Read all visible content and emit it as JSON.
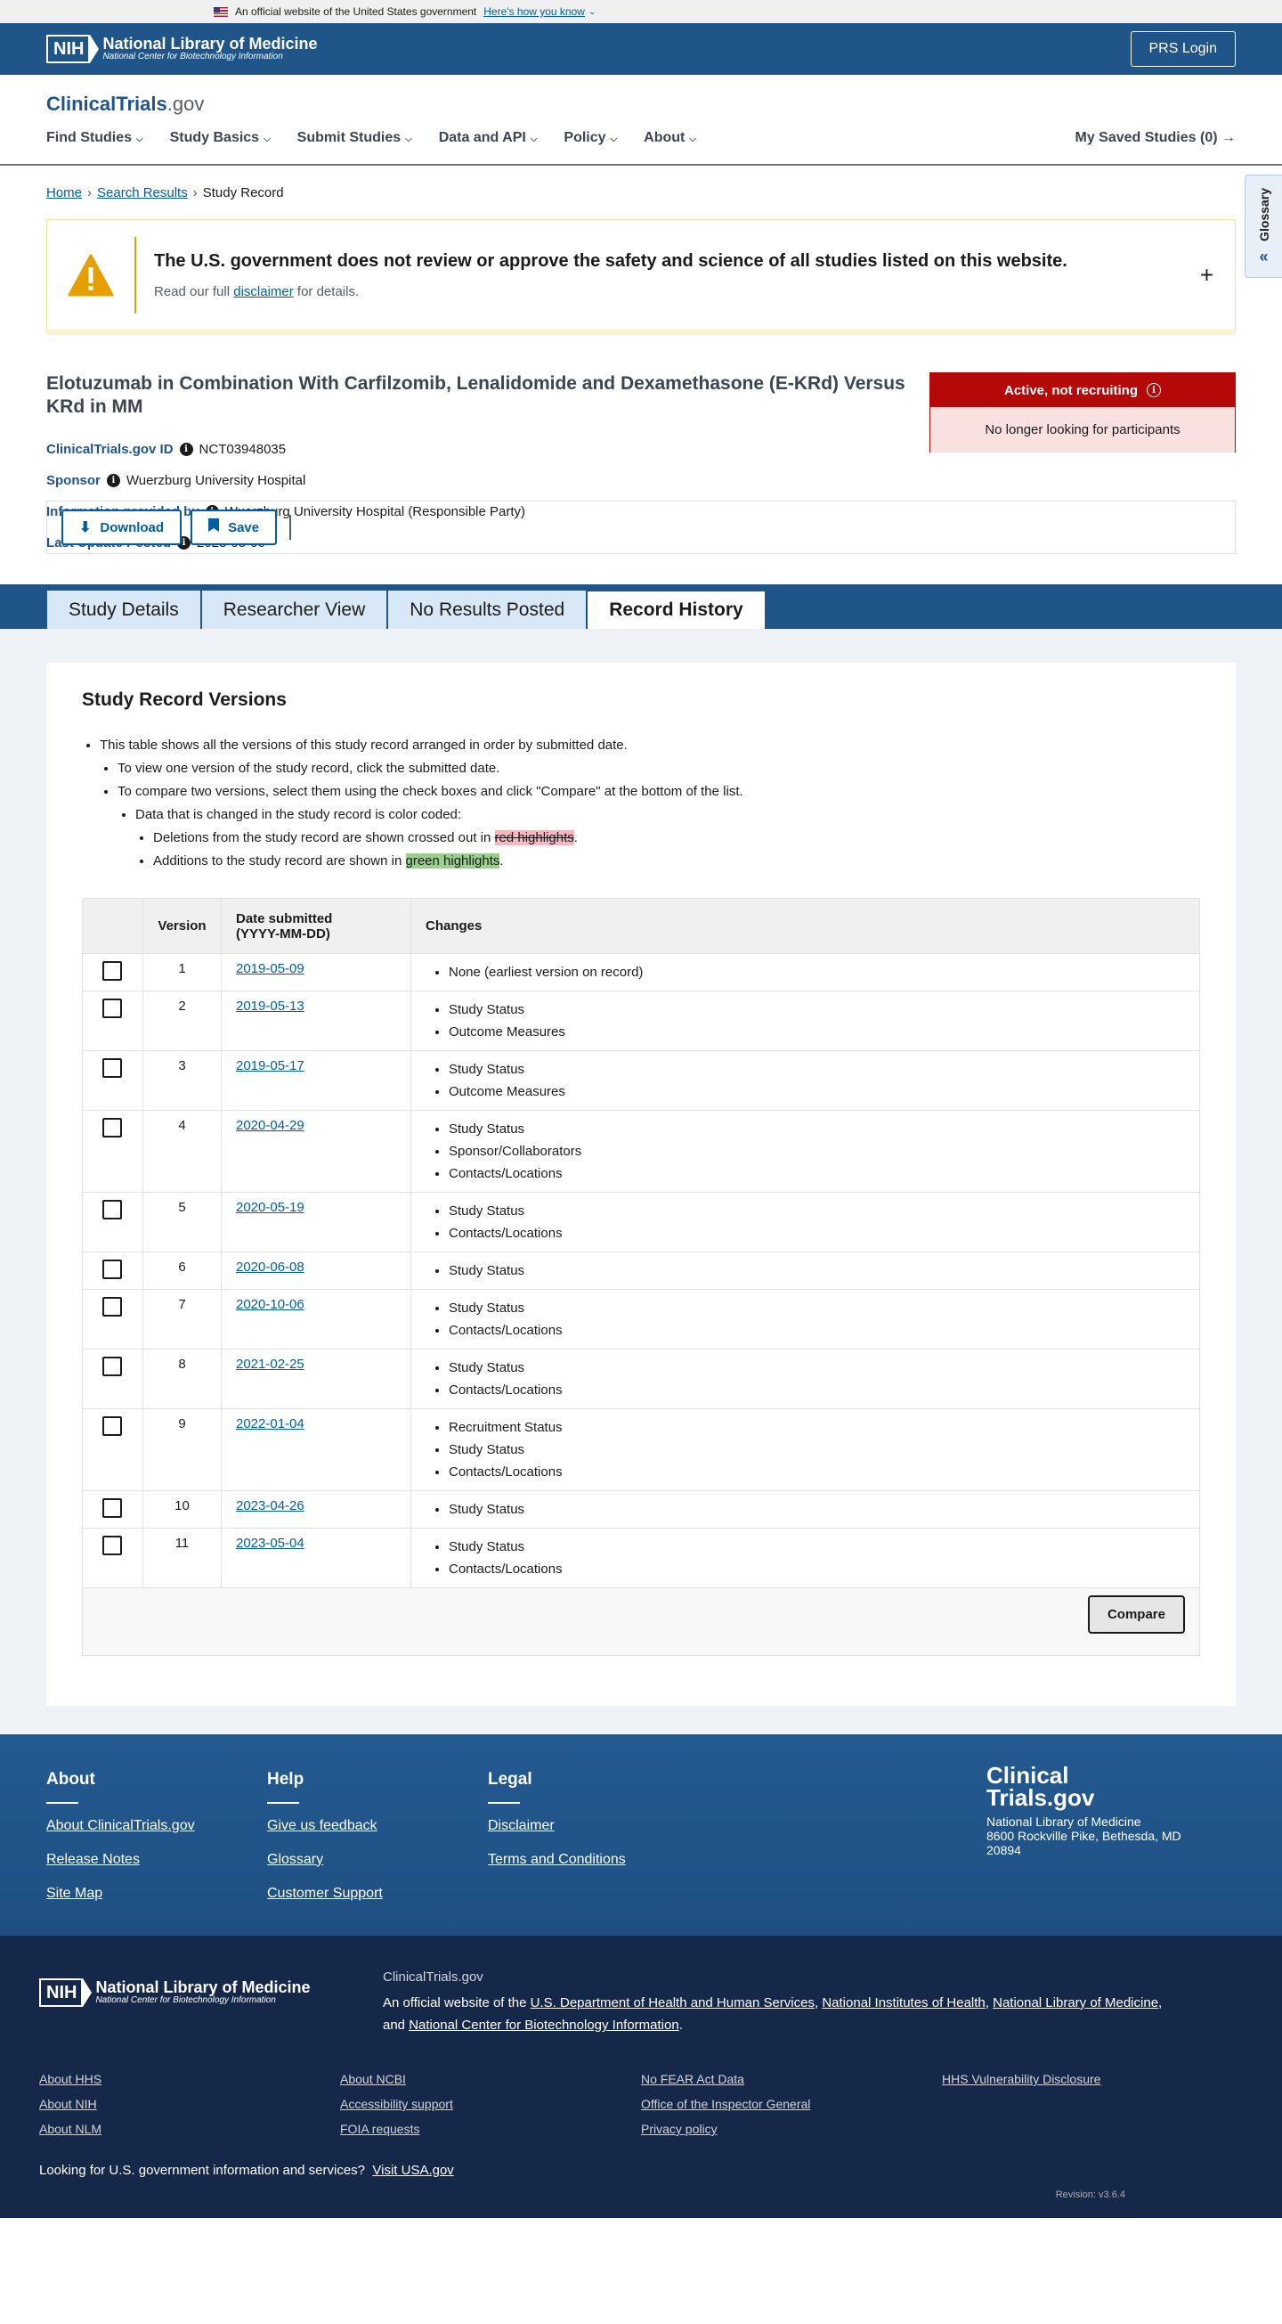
{
  "gov_banner": {
    "text": "An official website of the United States government",
    "link": "Here's how you know"
  },
  "nih": {
    "box": "NIH",
    "line1": "National Library of Medicine",
    "line2": "National Center for Biotechnology Information"
  },
  "prs_login": "PRS Login",
  "logo": {
    "main": "ClinicalTrials",
    "suffix": ".gov"
  },
  "nav": {
    "items": [
      "Find Studies",
      "Study Basics",
      "Submit Studies",
      "Data and API",
      "Policy",
      "About"
    ],
    "saved": "My Saved Studies (0)"
  },
  "glossary": "Glossary",
  "breadcrumb": {
    "home": "Home",
    "results": "Search Results",
    "current": "Study Record"
  },
  "alert": {
    "title": "The U.S. government does not review or approve the safety and science of all studies listed on this website.",
    "pre": "Read our full",
    "link": "disclaimer",
    "post": "for details."
  },
  "study": {
    "title": "Elotuzumab in Combination With Carfilzomib, Lenalidomide and Dexamethasone (E-KRd) Versus KRd in MM",
    "id_label": "ClinicalTrials.gov ID",
    "id": "NCT03948035",
    "sponsor_label": "Sponsor",
    "sponsor": "Wuerzburg University Hospital",
    "provided_label": "Information provided by",
    "provided": "Wuerzburg University Hospital (Responsible Party)",
    "update_label": "Last Update Posted",
    "update": "2023-05-06",
    "status": "Active, not recruiting",
    "status_sub": "No longer looking for participants"
  },
  "actions": {
    "download": "Download",
    "save": "Save"
  },
  "tabs": [
    "Study Details",
    "Researcher View",
    "No Results Posted",
    "Record History"
  ],
  "versions": {
    "title": "Study Record Versions",
    "b1": "This table shows all the versions of this study record arranged in order by submitted date.",
    "b2": "To view one version of the study record, click the submitted date.",
    "b3": "To compare two versions, select them using the check boxes and click \"Compare\" at the bottom of the list.",
    "b4": "Data that is changed in the study record is color coded:",
    "b5_pre": "Deletions from the study record are shown crossed out in",
    "b5_hl": "red highlights",
    "b6_pre": "Additions to the study record are shown in",
    "b6_hl": "green highlights",
    "columns": {
      "version": "Version",
      "date": "Date submitted",
      "date_fmt": "(YYYY-MM-DD)",
      "changes": "Changes"
    },
    "rows": [
      {
        "version": "1",
        "date": "2019-05-09",
        "changes": [
          "None (earliest version on record)"
        ]
      },
      {
        "version": "2",
        "date": "2019-05-13",
        "changes": [
          "Study Status",
          "Outcome Measures"
        ]
      },
      {
        "version": "3",
        "date": "2019-05-17",
        "changes": [
          "Study Status",
          "Outcome Measures"
        ]
      },
      {
        "version": "4",
        "date": "2020-04-29",
        "changes": [
          "Study Status",
          "Sponsor/Collaborators",
          "Contacts/Locations"
        ]
      },
      {
        "version": "5",
        "date": "2020-05-19",
        "changes": [
          "Study Status",
          "Contacts/Locations"
        ]
      },
      {
        "version": "6",
        "date": "2020-06-08",
        "changes": [
          "Study Status"
        ]
      },
      {
        "version": "7",
        "date": "2020-10-06",
        "changes": [
          "Study Status",
          "Contacts/Locations"
        ]
      },
      {
        "version": "8",
        "date": "2021-02-25",
        "changes": [
          "Study Status",
          "Contacts/Locations"
        ]
      },
      {
        "version": "9",
        "date": "2022-01-04",
        "changes": [
          "Recruitment Status",
          "Study Status",
          "Contacts/Locations"
        ]
      },
      {
        "version": "10",
        "date": "2023-04-26",
        "changes": [
          "Study Status"
        ]
      },
      {
        "version": "11",
        "date": "2023-05-04",
        "changes": [
          "Study Status",
          "Contacts/Locations"
        ]
      }
    ],
    "compare": "Compare"
  },
  "footer": {
    "about": {
      "head": "About",
      "links": [
        "About ClinicalTrials.gov",
        "Release Notes",
        "Site Map"
      ]
    },
    "help": {
      "head": "Help",
      "links": [
        "Give us feedback",
        "Glossary",
        "Customer Support"
      ]
    },
    "legal": {
      "head": "Legal",
      "links": [
        "Disclaimer",
        "Terms and Conditions"
      ]
    },
    "brand1": "Clinical",
    "brand2": "Trials.gov",
    "addr1": "National Library of Medicine",
    "addr2": "8600 Rockville Pike, Bethesda, MD",
    "addr3": "20894"
  },
  "footer_bottom": {
    "site": "ClinicalTrials.gov",
    "official_pre": "An official website of the",
    "hhs": "U.S. Department of Health and Human Services",
    "nih": "National Institutes of Health",
    "nlm": "National Library of Medicine",
    "and": "and",
    "ncbi": "National Center for Biotechnology Information",
    "col1": [
      "About HHS",
      "About NIH",
      "About NLM"
    ],
    "col2": [
      "About NCBI",
      "Accessibility support",
      "FOIA requests"
    ],
    "col3": [
      "No FEAR Act Data",
      "Office of the Inspector General",
      "Privacy policy"
    ],
    "col4": [
      "HHS Vulnerability Disclosure"
    ],
    "usa_pre": "Looking for U.S. government information and services?",
    "usa_link": "Visit USA.gov",
    "revision": "Revision: v3.6.4"
  },
  "colors": {
    "primary": "#20558a",
    "status_red": "#b50909",
    "link": "#005ea2",
    "warning": "#e5a000"
  }
}
